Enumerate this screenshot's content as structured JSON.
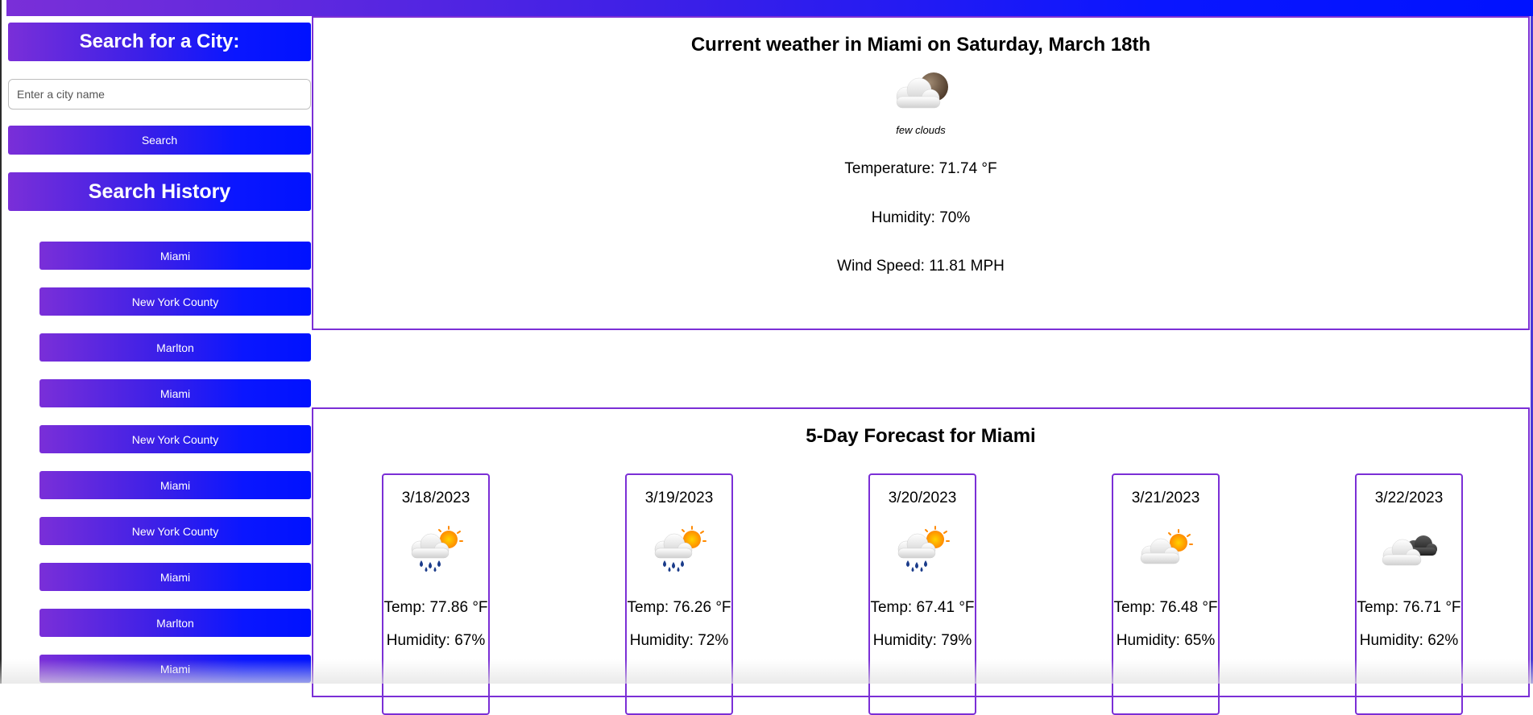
{
  "sidebar": {
    "search_title": "Search for a City:",
    "input_placeholder": "Enter a city name",
    "input_value": "",
    "search_button": "Search",
    "history_title": "Search History",
    "history": [
      "Miami",
      "New York County",
      "Marlton",
      "Miami",
      "New York County",
      "Miami",
      "New York County",
      "Miami",
      "Marlton",
      "Miami"
    ]
  },
  "current": {
    "title": "Current weather in Miami on Saturday, March 18th",
    "icon": "few-clouds-night-icon",
    "description": "few clouds",
    "temperature": "Temperature: 71.74 °F",
    "humidity": "Humidity: 70%",
    "wind": "Wind Speed: 11.81 MPH"
  },
  "forecast": {
    "title": "5-Day Forecast for Miami",
    "days": [
      {
        "date": "3/18/2023",
        "icon": "rain-sun-icon",
        "temp": "Temp: 77.86 °F",
        "humidity": "Humidity: 67%"
      },
      {
        "date": "3/19/2023",
        "icon": "rain-sun-icon",
        "temp": "Temp: 76.26 °F",
        "humidity": "Humidity: 72%"
      },
      {
        "date": "3/20/2023",
        "icon": "rain-sun-icon",
        "temp": "Temp: 67.41 °F",
        "humidity": "Humidity: 79%"
      },
      {
        "date": "3/21/2023",
        "icon": "cloud-sun-icon",
        "temp": "Temp: 76.48 °F",
        "humidity": "Humidity: 65%"
      },
      {
        "date": "3/22/2023",
        "icon": "broken-clouds-icon",
        "temp": "Temp: 76.71 °F",
        "humidity": "Humidity: 62%"
      }
    ]
  },
  "colors": {
    "gradient_start": "#7a2fd8",
    "gradient_end": "#0012ff",
    "border": "#7b2fd6"
  }
}
